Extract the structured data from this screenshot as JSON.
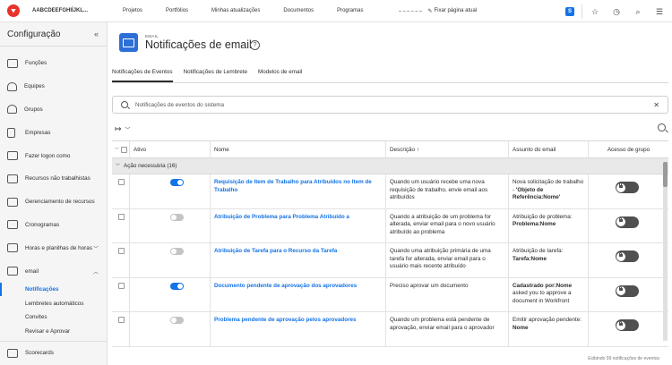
{
  "topbar": {
    "org": "AABCDEEFGHIÏJKL...",
    "nav": [
      "Projetos",
      "Portfólios",
      "Minhas atualizações",
      "Documentos",
      "Programas"
    ],
    "pin_label": "Fixar página atual",
    "badge": "S"
  },
  "sidebar": {
    "title": "Configuração",
    "items": [
      "Funções",
      "Equipes",
      "Grupos",
      "Empresas",
      "Fazer logon como",
      "Recursos não trabalhistas",
      "Gerenciamento de recursos",
      "Cronogramas",
      "Horas e planilhas de horas",
      "email"
    ],
    "email_subitems": [
      "Notificações",
      "Lembretes automáticos",
      "Convites",
      "Revisar e Aprovar"
    ],
    "last_item": "Scorecards"
  },
  "header": {
    "kicker": "EMAIL",
    "title": "Notificações de email"
  },
  "tabs": [
    "Notificações de Eventos",
    "Notificações de Lembrete",
    "Modelos de email"
  ],
  "search": {
    "placeholder": "Notificações de eventos do sistema"
  },
  "table": {
    "headers": {
      "active": "Ativo",
      "name": "Nome",
      "description": "Descrição ↑",
      "subject": "Assunto do email",
      "access": "Acesso de grupo"
    },
    "group": "Ação necessária (16)",
    "rows": [
      {
        "active": true,
        "name": "Requisição de Item de Trabalho para Atribuídos no Item de Trabalho",
        "description": "Quando um usuário recebe uma nova requisição de trabalho, envie email aos atribuídos",
        "subject_pre": "Nova solicitação de trabalho - ",
        "subject_bold": "'Objeto de Referência:Nome'"
      },
      {
        "active": false,
        "name": "Atribuição de Problema para Problema Atribuído a",
        "description": "Quando a atribuição de um problema for alterada, enviar email para o novo usuário atribuído ao problema",
        "subject_pre": "Atribuição de problema: ",
        "subject_bold": "Problema:Nome"
      },
      {
        "active": false,
        "name": "Atribuição de Tarefa para o Recurso da Tarefa",
        "description": "Quando uma atribuição primária de uma tarefa for alterada, enviar email para o usuário mais recente atribuído",
        "subject_pre": "Atribuição de tarefa: ",
        "subject_bold": "Tarefa:Nome"
      },
      {
        "active": true,
        "name": "Documento pendente de aprovação dos aprovadores",
        "description": "Preciso aprovar um documento",
        "subject_pre": "",
        "subject_bold": "Cadastrado por:Nome",
        "subject_post": " asked you to approve a document in Workfront"
      },
      {
        "active": false,
        "name": "Problema pendente de aprovação pelos aprovadores",
        "description": "Quando um problema está pendente de aprovação, enviar email para o aprovador",
        "subject_pre": "Emitir aprovação pendente: ",
        "subject_bold": "Nome"
      }
    ]
  },
  "footer": "Exibindo 99 notificações de eventos",
  "colors": {
    "accent": "#1473e6",
    "brand": "#e8322c"
  }
}
